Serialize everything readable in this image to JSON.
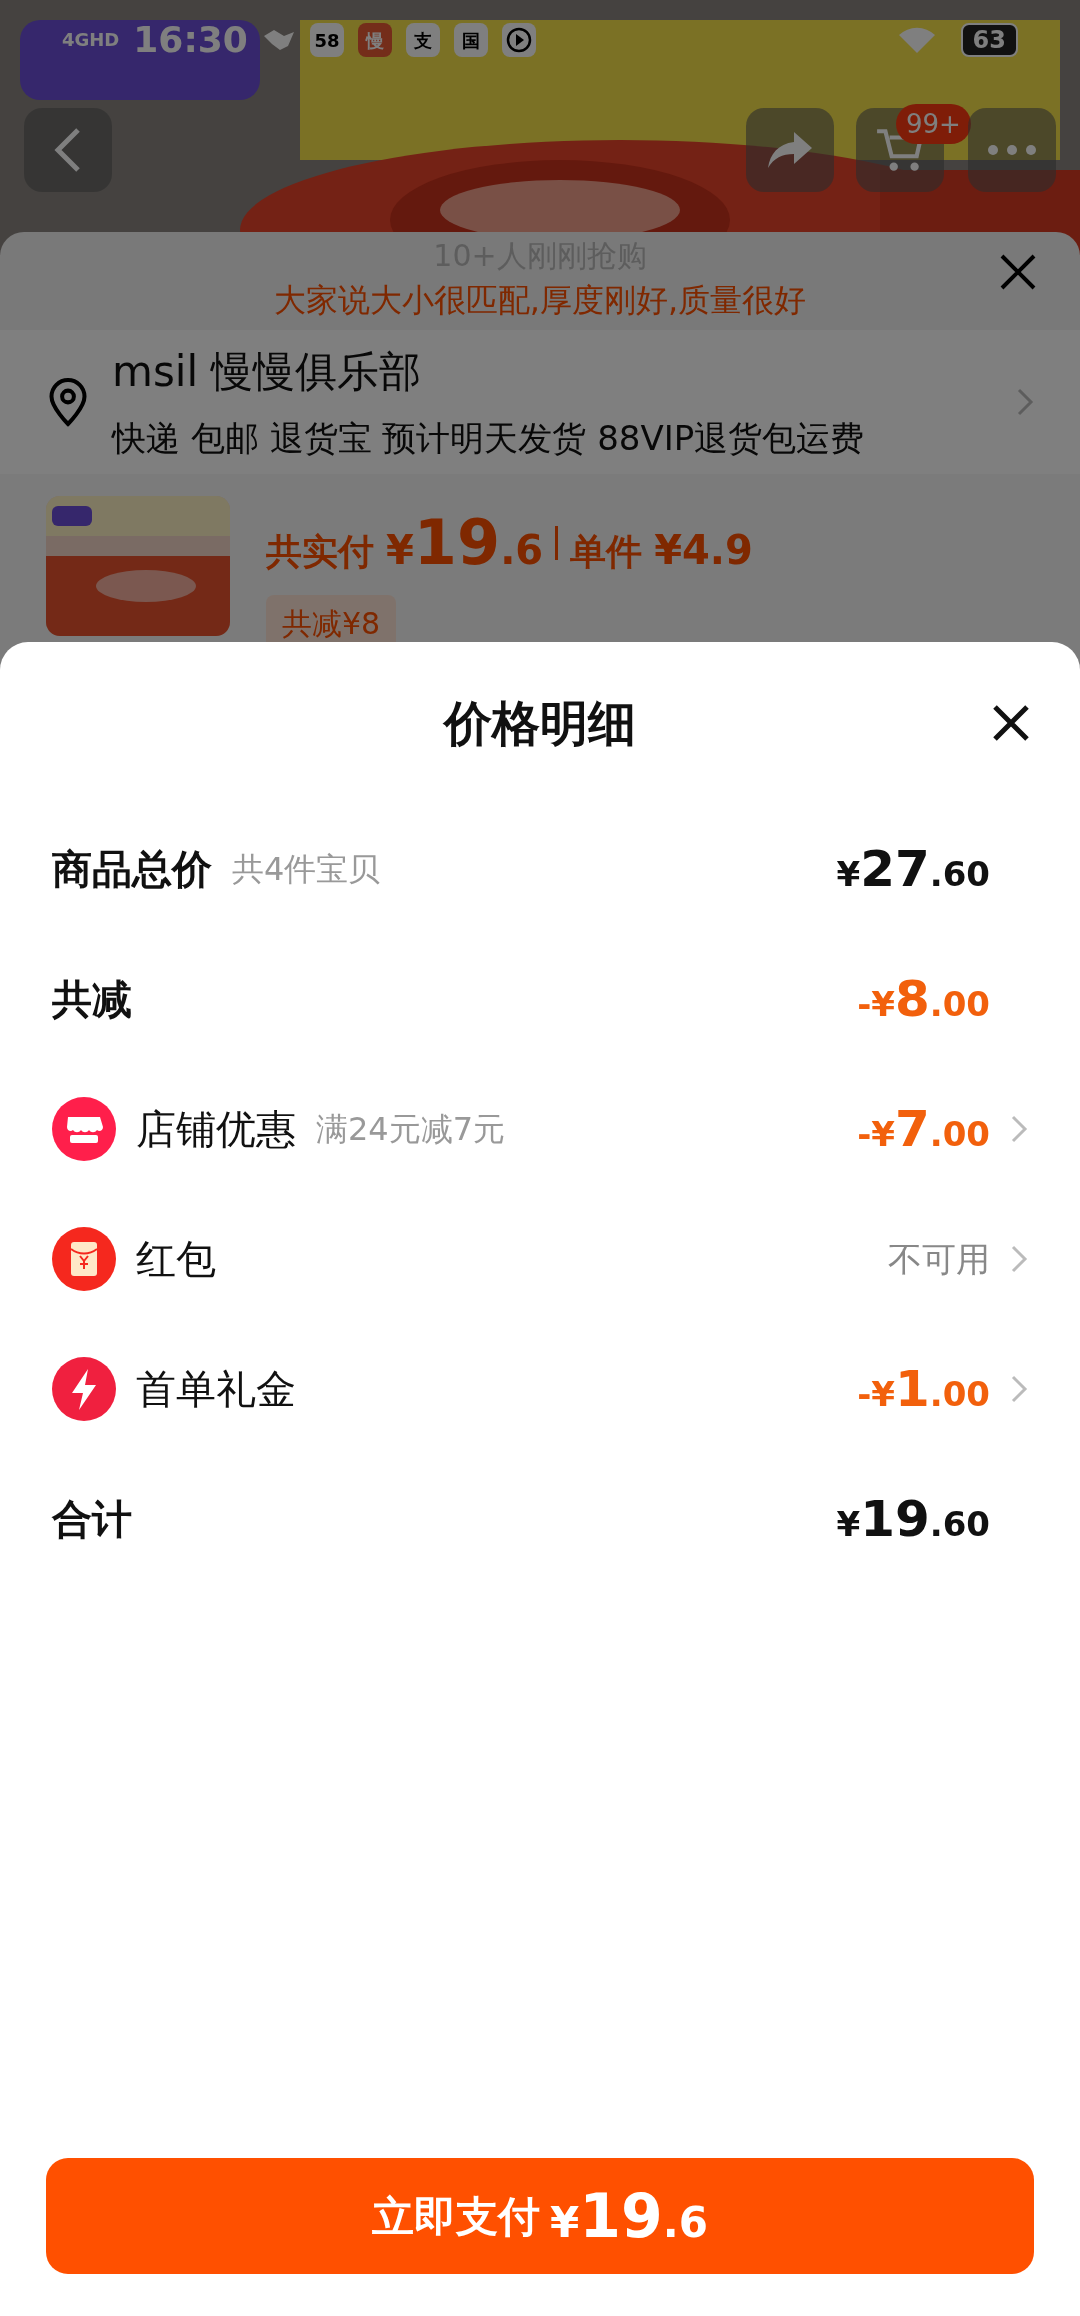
{
  "status_bar": {
    "network": "4GHD",
    "time": "16:30",
    "app_badges": [
      "58",
      "慢",
      "支",
      "国"
    ],
    "battery": "63"
  },
  "product_header": {
    "kind": "picture",
    "cart_badge": "99+"
  },
  "order_sheet": {
    "social_proof": "10+人刚刚抢购",
    "review": "大家说大小很匹配,厚度刚好,质量很好",
    "address_name": "msil 慢慢俱乐部",
    "delivery": "快递 包邮 退货宝 预计明天发货 88VIP退货包运费",
    "paid_label": "共实付",
    "paid_price": "¥19.6",
    "unit_label": "单件",
    "unit_price": "¥4.9",
    "discount_chip": "共减¥8"
  },
  "price_detail": {
    "title": "价格明细",
    "rows": [
      {
        "kind": "plain",
        "label": "商品总价",
        "note": "共4件宝贝",
        "value": "¥27.60",
        "color": "#111111",
        "arrow": false
      },
      {
        "kind": "plain",
        "label": "共减",
        "value": "-¥8.00",
        "color": "#f2600c",
        "arrow": false
      },
      {
        "kind": "store",
        "label": "店铺优惠",
        "note": "满24元减7元",
        "value": "-¥7.00",
        "color": "#f2600c",
        "arrow": true
      },
      {
        "kind": "envelope",
        "label": "红包",
        "value": "不可用",
        "color": "#888888",
        "arrow": true
      },
      {
        "kind": "bolt",
        "label": "首单礼金",
        "value": "-¥1.00",
        "color": "#f2600c",
        "arrow": true
      },
      {
        "kind": "plain",
        "label": "合计",
        "value": "¥19.60",
        "color": "#111111",
        "arrow": false
      }
    ]
  },
  "pay_button": {
    "label": "立即支付",
    "price": "¥19.6"
  }
}
